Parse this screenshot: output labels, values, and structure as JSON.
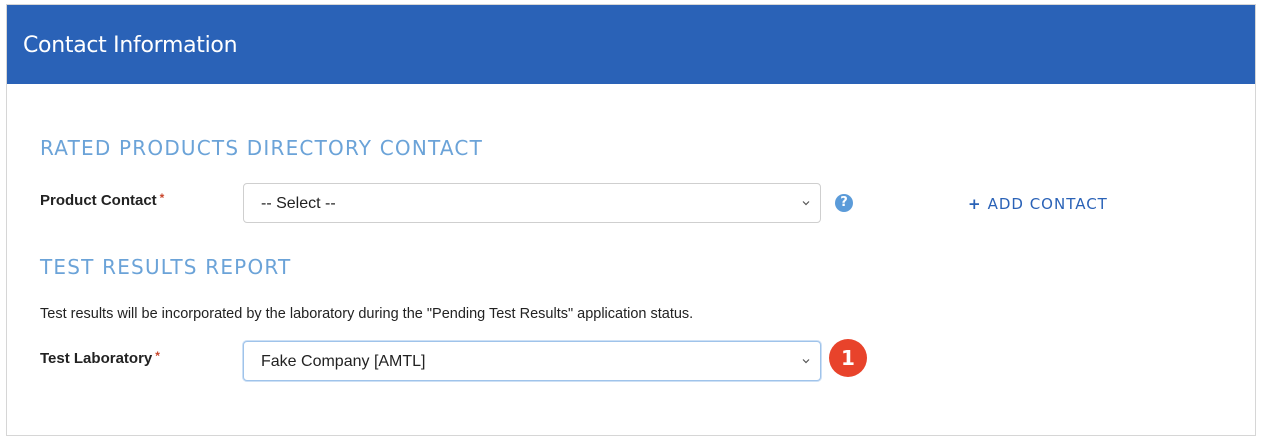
{
  "header": {
    "title": "Contact Information"
  },
  "directory_section": {
    "heading": "RATED PRODUCTS DIRECTORY CONTACT",
    "product_contact": {
      "label": "Product Contact",
      "required_mark": "*",
      "selected": "-- Select --",
      "help_glyph": "?",
      "help_icon": "question-circle-icon"
    },
    "add_contact": {
      "plus": "+",
      "label": "ADD CONTACT"
    }
  },
  "test_section": {
    "heading": "TEST RESULTS REPORT",
    "description": "Test results will be incorporated by the laboratory during the \"Pending Test Results\" application status.",
    "test_laboratory": {
      "label": "Test Laboratory",
      "required_mark": "*",
      "selected": "Fake Company [AMTL]"
    }
  },
  "annotation": {
    "number": "1",
    "color": "#e8432b"
  },
  "colors": {
    "header_bg": "#2a62b7",
    "heading": "#6ba3d8",
    "required": "#c9462c",
    "link": "#2a62b7"
  }
}
